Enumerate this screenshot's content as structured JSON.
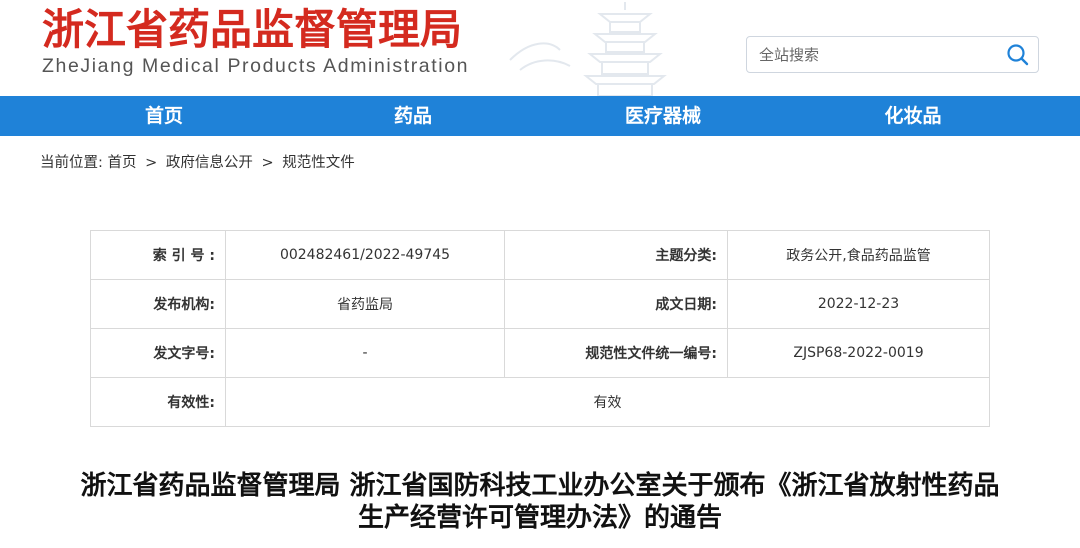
{
  "header": {
    "site_title": "浙江省药品监督管理局",
    "site_subtitle": "ZheJiang Medical Products Administration",
    "search_placeholder": "全站搜索"
  },
  "nav": {
    "items": [
      {
        "label": "首页"
      },
      {
        "label": "药品"
      },
      {
        "label": "医疗器械"
      },
      {
        "label": "化妆品"
      }
    ]
  },
  "breadcrumb": {
    "prefix": "当前位置:",
    "items": [
      "首页",
      "政府信息公开",
      "规范性文件"
    ],
    "separator": ">"
  },
  "info": {
    "index_label": "索 引 号 :",
    "index_value": "002482461/2022-49745",
    "category_label": "主题分类:",
    "category_value": "政务公开,食品药品监管",
    "publisher_label": "发布机构:",
    "publisher_value": "省药监局",
    "date_label": "成文日期:",
    "date_value": "2022-12-23",
    "docno_label": "发文字号:",
    "docno_value": "-",
    "code_label": "规范性文件统一编号:",
    "code_value": "ZJSP68-2022-0019",
    "validity_label": "有效性:",
    "validity_value": "有效"
  },
  "article": {
    "title_line1": "浙江省药品监督管理局 浙江省国防科技工业办公室关于颁布《浙江省放射性药品",
    "title_line2": "生产经营许可管理办法》的通告"
  },
  "colors": {
    "brand_red": "#d42a1f",
    "nav_blue": "#1f82d8"
  }
}
